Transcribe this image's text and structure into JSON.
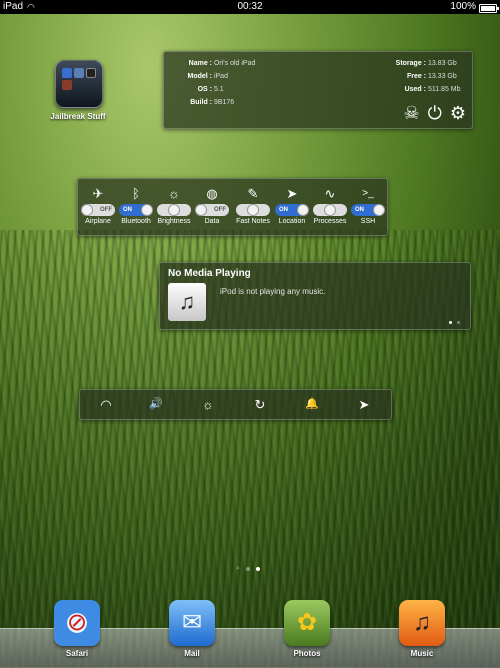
{
  "statusbar": {
    "device": "iPad",
    "time": "00:32",
    "battery": "100%"
  },
  "folder": {
    "label": "Jailbreak Stuff"
  },
  "info": {
    "name_label": "Name :",
    "name": "Ori's old iPad",
    "model_label": "Model :",
    "model": "iPad",
    "os_label": "OS :",
    "os": "5.1",
    "build_label": "Build :",
    "build": "9B176",
    "storage_label": "Storage :",
    "storage": "13.83 Gb",
    "free_label": "Free :",
    "free": "13.33 Gb",
    "used_label": "Used :",
    "used": "511.85 Mb"
  },
  "toggles": [
    {
      "label": "Airplane",
      "state": "OFF",
      "icon": "airplane-icon",
      "glyph": "✈"
    },
    {
      "label": "Bluetooth",
      "state": "ON",
      "icon": "bluetooth-icon",
      "glyph": "ᛒ"
    },
    {
      "label": "Brightness",
      "state": "",
      "icon": "sun-icon",
      "glyph": "☼"
    },
    {
      "label": "Data",
      "state": "OFF",
      "icon": "globe-icon",
      "glyph": "◍"
    },
    {
      "label": "Fast Notes",
      "state": "",
      "icon": "pencil-icon",
      "glyph": "✎"
    },
    {
      "label": "Location",
      "state": "ON",
      "icon": "location-arrow-icon",
      "glyph": "➤"
    },
    {
      "label": "Processes",
      "state": "",
      "icon": "pulse-icon",
      "glyph": "∿"
    },
    {
      "label": "SSH",
      "state": "ON",
      "icon": "terminal-icon",
      "glyph": ">_"
    }
  ],
  "media": {
    "title": "No Media Playing",
    "message": "iPod is not playing any music.",
    "art_icon": "music-note-icon"
  },
  "quickbar": [
    {
      "icon": "wifi-icon",
      "glyph": "◠"
    },
    {
      "icon": "volume-icon",
      "glyph": "🔊"
    },
    {
      "icon": "brightness-icon",
      "glyph": "☼"
    },
    {
      "icon": "rotation-lock-icon",
      "glyph": "↻"
    },
    {
      "icon": "bell-icon",
      "glyph": "🔔"
    },
    {
      "icon": "location-icon",
      "glyph": "➤"
    }
  ],
  "dock": {
    "apps": [
      {
        "label": "Safari",
        "icon": "safari-icon",
        "glyph": "⊘"
      },
      {
        "label": "Mail",
        "icon": "mail-icon",
        "glyph": "✉"
      },
      {
        "label": "Photos",
        "icon": "photos-icon",
        "glyph": "✿"
      },
      {
        "label": "Music",
        "icon": "music-icon",
        "glyph": "♫"
      }
    ]
  }
}
